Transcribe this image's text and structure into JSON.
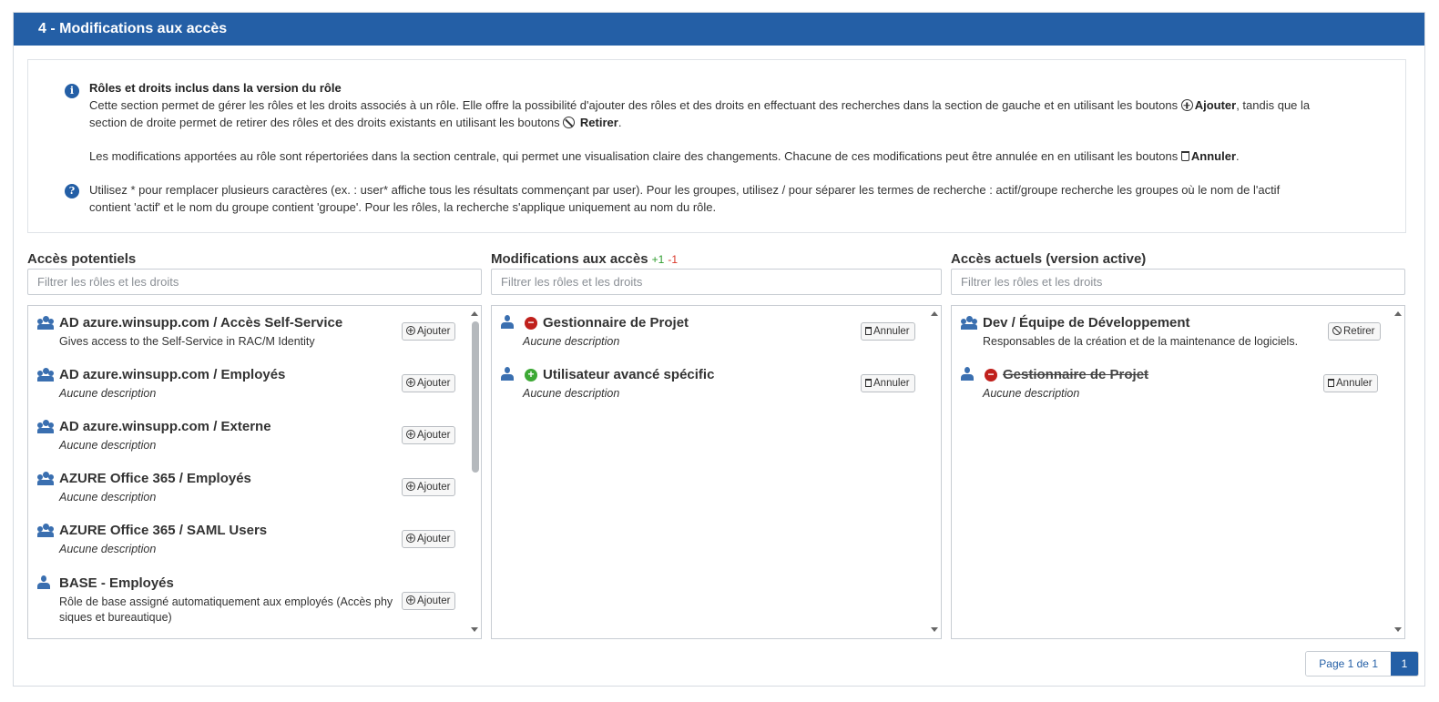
{
  "section": {
    "title": "4 - Modifications aux accès"
  },
  "info": {
    "heading": "Rôles et droits inclus dans la version du rôle",
    "para1_a": "Cette section permet de gérer les rôles et les droits associés à un rôle. Elle offre la possibilité d'ajouter des rôles et des droits en effectuant des recherches dans la section de gauche et en utilisant les boutons ",
    "para1_add": "Ajouter",
    "para1_b": ", tandis que la",
    "para1_c": "section de droite permet de retirer des rôles et des droits existants en utilisant les boutons ",
    "para1_remove": "Retirer",
    "para2_a": "Les modifications apportées au rôle sont répertoriées dans la section centrale, qui permet une visualisation claire des changements. Chacune de ces modifications peut être annulée en en utilisant les boutons ",
    "para2_cancel": "Annuler",
    "help1": "Utilisez * pour remplacer plusieurs caractères (ex. : user* affiche tous les résultats commençant par user). Pour les groupes, utilisez / pour séparer les termes de recherche : actif/groupe recherche les groupes où le nom de l'actif",
    "help2": "contient 'actif' et le nom du groupe contient 'groupe'. Pour les rôles, la recherche s'applique uniquement au nom du rôle."
  },
  "columns": {
    "potential": {
      "title": "Accès potentiels",
      "placeholder": "Filtrer les rôles et les droits"
    },
    "changes": {
      "title": "Modifications aux accès",
      "plus": "+1",
      "minus": "-1",
      "placeholder": "Filtrer les rôles et les droits"
    },
    "current": {
      "title": "Accès actuels (version active)",
      "placeholder": "Filtrer les rôles et les droits"
    }
  },
  "potential_items": [
    {
      "icon": "group-icon",
      "title": "AD azure.winsupp.com / Accès Self-Service",
      "desc": "Gives access to the Self-Service in RAC/M Identity",
      "button": "Ajouter"
    },
    {
      "icon": "group-icon",
      "title": "AD azure.winsupp.com / Employés",
      "desc": "Aucune description",
      "button": "Ajouter"
    },
    {
      "icon": "group-icon",
      "title": "AD azure.winsupp.com / Externe",
      "desc": "Aucune description",
      "button": "Ajouter"
    },
    {
      "icon": "group-icon",
      "title": "AZURE Office 365 / Employés",
      "desc": "Aucune description",
      "button": "Ajouter"
    },
    {
      "icon": "group-icon",
      "title": "AZURE Office 365 / SAML Users",
      "desc": "Aucune description",
      "button": "Ajouter"
    },
    {
      "icon": "user-icon",
      "title": "BASE - Employés",
      "desc1": "Rôle de base assigné automatiquement aux employés (Accès phy",
      "desc2": "siques et bureautique)",
      "button": "Ajouter"
    }
  ],
  "change_items": [
    {
      "icon": "user-icon",
      "status": "removed",
      "title": "Gestionnaire de Projet",
      "desc": "Aucune description",
      "button": "Annuler"
    },
    {
      "icon": "user-icon",
      "status": "added",
      "title": "Utilisateur avancé spécific",
      "desc": "Aucune description",
      "button": "Annuler"
    }
  ],
  "current_items": [
    {
      "icon": "group-icon",
      "title": "Dev / Équipe de Développement",
      "desc": "Responsables de la création et de la maintenance de logiciels.",
      "button": "Retirer"
    },
    {
      "icon": "user-icon",
      "status": "removed",
      "title": "Gestionnaire de Projet",
      "desc": "Aucune description",
      "button": "Annuler"
    }
  ],
  "pager": {
    "info": "Page 1 de 1",
    "current": "1"
  },
  "colors": {
    "primary": "#245fa6",
    "added": "#3da935",
    "removed": "#c0201c"
  }
}
